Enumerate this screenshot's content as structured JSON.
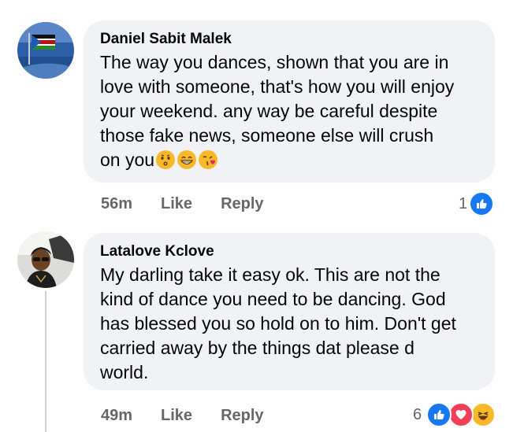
{
  "comments": [
    {
      "author": "Daniel Sabit Malek",
      "text": "The way you dances, shown that you are in\nlove with someone, that's how you will enjoy\nyour weekend. any way be careful despite\nthose fake news, someone else will crush\non you",
      "emojis": [
        "worried-kiss-emoji",
        "grin-emoji",
        "kiss-heart-emoji"
      ],
      "time": "56m",
      "like_label": "Like",
      "reply_label": "Reply",
      "reaction_count": "1",
      "reactions": [
        "like-icon"
      ]
    },
    {
      "author": "Latalove Kclove",
      "text": "My darling take it easy ok. This are not the\nkind of dance you need to be dancing.  God\nhas blessed you so hold on to him. Don't get\ncarried away by the things dat please d\nworld.",
      "time": "49m",
      "like_label": "Like",
      "reply_label": "Reply",
      "reaction_count": "6",
      "reactions": [
        "like-icon",
        "love-icon",
        "haha-icon"
      ]
    }
  ],
  "colors": {
    "bubble": "#f0f2f5",
    "like": "#1877f2",
    "love": "#f33e58",
    "haha": "#f7b928",
    "meta": "#65676b"
  }
}
